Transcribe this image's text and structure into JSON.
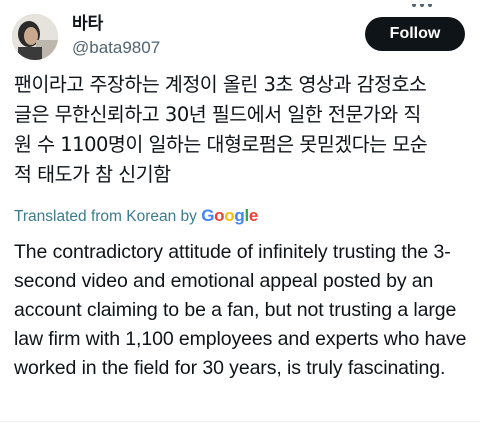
{
  "user": {
    "display_name": "바타",
    "handle": "@bata9807"
  },
  "follow_button": {
    "label": "Follow"
  },
  "tweet": {
    "original_text": "팬이라고 주장하는 계정이 올린 3초 영상과 감정호소\n글은 무한신뢰하고 30년 필드에서 일한 전문가와 직\n원 수 1100명이 일하는 대형로펌은 못믿겠다는 모순\n적 태도가 참 신기함",
    "translated_label": "Translated from Korean by ",
    "translator": {
      "letters": [
        "G",
        "o",
        "o",
        "g",
        "l",
        "e"
      ],
      "colors": [
        "#4285F4",
        "#EA4335",
        "#FBBC05",
        "#4285F4",
        "#34A853",
        "#EA4335"
      ]
    },
    "translation_text": "The contradictory attitude of infinitely trusting the 3-second video and emotional appeal posted by an account claiming to be a fan, but not trusting a large law firm with 1,100 employees and experts who have worked in the field for 30 years, is truly fascinating."
  },
  "icons": {
    "more": "more-dots-icon",
    "avatar": "avatar-photo"
  },
  "colors": {
    "follow_bg": "#0f1419",
    "handle": "#536471",
    "translated_link": "#3a7c8c"
  }
}
